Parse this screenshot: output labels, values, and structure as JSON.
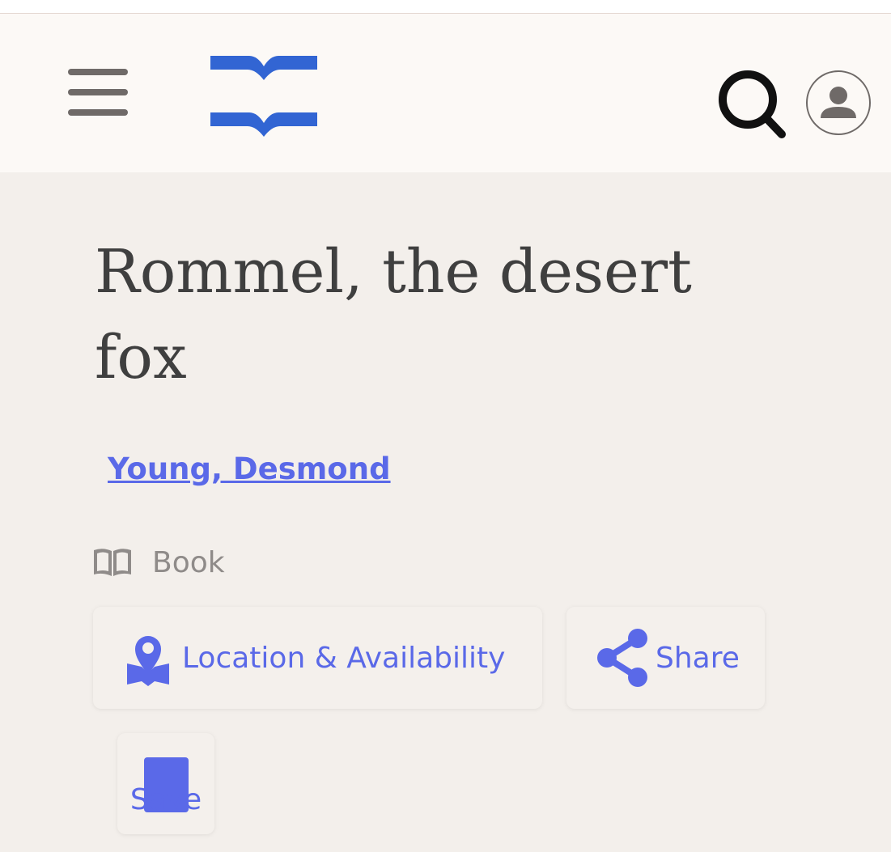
{
  "header": {
    "menu_icon": "hamburger-menu-icon",
    "logo_icon": "library-logo-icon",
    "search_icon": "search-icon",
    "account_icon": "user-account-icon"
  },
  "record": {
    "title": "Rommel, the desert fox",
    "author": "Young, Desmond",
    "format_icon": "open-book-icon",
    "format": "Book"
  },
  "actions": {
    "location_label": "Location & Availability",
    "share_label": "Share",
    "save_label": "Save"
  },
  "colors": {
    "accent": "#5a69e8",
    "logo_blue": "#3265d3",
    "title_text": "#3f3f3f",
    "page_background": "#f3efeb",
    "header_background": "#fcf9f6"
  }
}
